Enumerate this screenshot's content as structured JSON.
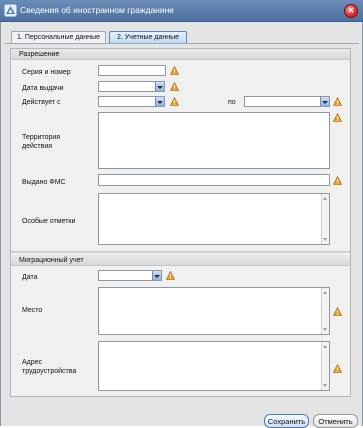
{
  "window": {
    "title": "Сведения об иностранном гражданине",
    "icon": "app-icon",
    "close_icon": "close-icon"
  },
  "tabs": [
    {
      "label": "1. Персональные данные",
      "active": false
    },
    {
      "label": "2. Учетные данные",
      "active": true
    }
  ],
  "permit_section": {
    "title": "Разрешение",
    "series_number": {
      "label": "Серия и номер",
      "value": ""
    },
    "issue_date": {
      "label": "Дата выдачи",
      "value": ""
    },
    "valid_from": {
      "label": "Действует с",
      "value": ""
    },
    "valid_to": {
      "label": "по",
      "value": ""
    },
    "territory": {
      "label": "Территория действия",
      "value": ""
    },
    "issued_by": {
      "label": "Выдано ФМС",
      "value": ""
    },
    "special_marks": {
      "label": "Особые отметки",
      "value": ""
    }
  },
  "migration_section": {
    "title": "Миграционный учет",
    "date": {
      "label": "Дата",
      "value": ""
    },
    "place": {
      "label": "Место",
      "value": ""
    },
    "work_address": {
      "label": "Адрес трудоустройства",
      "value": ""
    }
  },
  "buttons": {
    "save": "Сохранить",
    "cancel": "Отменить"
  },
  "colors": {
    "title_bar": "#5a7eae",
    "warning": "#e9a320",
    "active_tab": "#bcd8f2"
  }
}
